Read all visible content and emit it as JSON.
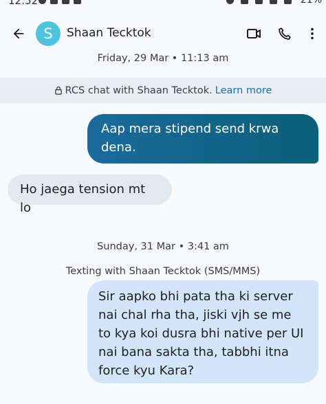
{
  "status_bar": {
    "time": "12:52",
    "battery": "21%"
  },
  "header": {
    "avatar_letter": "S",
    "contact_name": "Shaan Tecktok"
  },
  "conversation": {
    "date_1": "Friday, 29 Mar • 11:13 am",
    "rcs_notice": "RCS chat with Shaan Tecktok.",
    "rcs_learn_more": "Learn more",
    "msg_1": "Aap mera stipend send krwa dena.",
    "msg_2": "Ho jaega tension mt lo",
    "date_2": "Sunday, 31 Mar • 3:41 am",
    "sms_notice": "Texting with Shaan Tecktok (SMS/MMS)",
    "msg_3": "Sir aapko bhi pata tha ki server nai chal rha tha, jiski vjh se me to kya koi dusra bhi native per UI nai bana sakta tha, tabbhi itna force kyu Kara?"
  },
  "colors": {
    "avatar": "#4fc3de",
    "outgoing_rcs": "#0b5f79",
    "incoming": "#e3e9f0",
    "outgoing_sms": "#d3e5fb",
    "link": "#1a6fb5"
  },
  "icons": [
    "arrow-back-icon",
    "video-call-icon",
    "phone-icon",
    "more-vert-icon",
    "lock-icon"
  ]
}
